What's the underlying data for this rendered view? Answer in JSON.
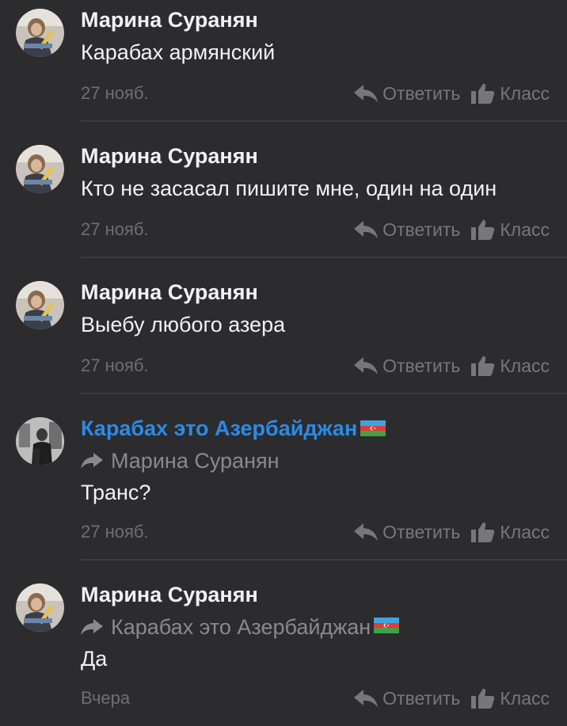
{
  "comments": [
    {
      "author": "Марина Суранян",
      "author_is_link": false,
      "reply_to": "",
      "text": "Карабах армянский",
      "date": "27 нояб.",
      "reply_label": "Ответить",
      "like_label": "Класс"
    },
    {
      "author": "Марина Суранян",
      "author_is_link": false,
      "reply_to": "",
      "text": "Кто не засасал пишите мне, один на один",
      "date": "27 нояб.",
      "reply_label": "Ответить",
      "like_label": "Класс"
    },
    {
      "author": "Марина Суранян",
      "author_is_link": false,
      "reply_to": "",
      "text": "Выебу любого азера",
      "date": "27 нояб.",
      "reply_label": "Ответить",
      "like_label": "Класс"
    },
    {
      "author": "Карабах это Азербайджан",
      "author_is_link": true,
      "reply_to": "Марина Суранян",
      "text": "Транс?",
      "date": "27 нояб.",
      "reply_label": "Ответить",
      "like_label": "Класс"
    },
    {
      "author": "Марина Суранян",
      "author_is_link": false,
      "reply_to": "Карабах это Азербайджан",
      "text": "Да",
      "date": "Вчера",
      "reply_label": "Ответить",
      "like_label": "Класс"
    }
  ],
  "colors": {
    "background": "#2c2c2e",
    "author_link": "#2d8ae6",
    "text": "#f2f2f2",
    "muted": "#77777b"
  },
  "icons": {
    "reply": "reply-arrow-icon",
    "like": "thumbs-up-icon",
    "reply_to": "forward-arrow-icon",
    "flag": "azerbaijan-flag-icon"
  }
}
